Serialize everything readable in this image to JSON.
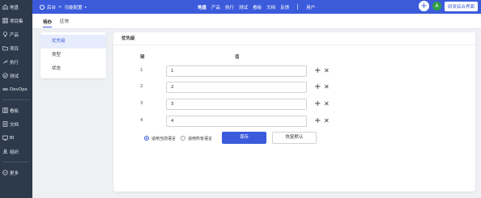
{
  "sidebar": {
    "items": [
      {
        "label": "地盘",
        "icon": "home-icon"
      },
      {
        "label": "项目集",
        "icon": "grid-icon"
      },
      {
        "label": "产品",
        "icon": "lightbulb-icon"
      },
      {
        "label": "项目",
        "icon": "folder-icon"
      },
      {
        "label": "执行",
        "icon": "run-icon"
      },
      {
        "label": "测试",
        "icon": "check-circle-icon"
      },
      {
        "label": "DevOps",
        "icon": "infinity-icon"
      },
      {
        "label": "看板",
        "icon": "board-icon"
      },
      {
        "label": "文档",
        "icon": "doc-icon"
      },
      {
        "label": "BI",
        "icon": "chart-icon"
      },
      {
        "label": "组织",
        "icon": "people-icon"
      },
      {
        "label": "更多",
        "icon": "more-icon"
      }
    ]
  },
  "topbar": {
    "breadcrumb_home": "后台",
    "breadcrumb_current": "功能配置",
    "nav": [
      "地盘",
      "产品",
      "执行",
      "测试",
      "看板",
      "文档",
      "反馈"
    ],
    "nav_user": "用户",
    "avatar_letter": "A",
    "ui_switch": "研发综合界面"
  },
  "tabs": [
    "待办",
    "区块"
  ],
  "menu": [
    "优先级",
    "类型",
    "状态"
  ],
  "panel": {
    "title": "优先级",
    "key_header": "键",
    "value_header": "值",
    "rows": [
      {
        "key": "1",
        "value": "1"
      },
      {
        "key": "2",
        "value": "2"
      },
      {
        "key": "3",
        "value": "3"
      },
      {
        "key": "4",
        "value": "4"
      }
    ],
    "radio_current": "适用当前语言",
    "radio_all": "适用所有语言",
    "save_label": "保存",
    "reset_label": "恢复默认"
  },
  "colors": {
    "primary": "#3b5bdb",
    "sidebar": "#2d3a4c"
  }
}
